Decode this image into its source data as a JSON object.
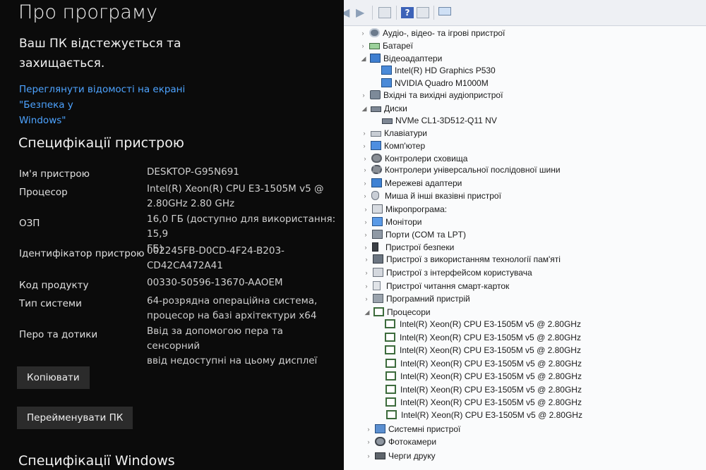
{
  "settings": {
    "page_title": "Про програму",
    "protection_line1": "Ваш ПК відстежується та",
    "protection_line2": "захищається.",
    "security_link_line1": "Переглянути відомості на екрані \"Безпека у",
    "security_link_line2": "Windows\"",
    "device_specs_title": "Специфікації пристрою",
    "specs": [
      {
        "label": "Ім'я пристрою",
        "value_line1": "DESKTOP-G95N691",
        "value_line2": ""
      },
      {
        "label": "Процесор",
        "value_line1": "Intel(R) Xeon(R) CPU E3-1505M v5 @",
        "value_line2": "2.80GHz   2.80 GHz"
      },
      {
        "label": "ОЗП",
        "value_line1": "16,0 ГБ (доступно для використання: 15,9",
        "value_line2": "ГБ)"
      },
      {
        "label": "Ідентифікатор пристрою",
        "value_line1": "002245FB-D0CD-4F24-B203-",
        "value_line2": "CD42CA472A41"
      },
      {
        "label": "Код продукту",
        "value_line1": "00330-50596-13670-AAOEM",
        "value_line2": ""
      },
      {
        "label": "Тип системи",
        "value_line1": "64-розрядна операційна система,",
        "value_line2": "процесор на базі архітектури x64"
      },
      {
        "label": "Перо та дотики",
        "value_line1": "Ввід за допомогою пера та сенсорний",
        "value_line2": "ввід недоступні на цьому дисплеї"
      }
    ],
    "copy_button": "Копіювати",
    "rename_button": "Перейменувати ПК",
    "windows_specs_title": "Специфікації Windows"
  },
  "device_manager": {
    "toolbar_icons": [
      "back-arrow-icon",
      "forward-arrow-icon",
      "properties-icon",
      "help-icon",
      "view-icon",
      "monitor-scan-icon"
    ],
    "help_glyph": "?",
    "tree": [
      {
        "label": "Аудіо-, відео- та ігрові пристрої",
        "expanded": false,
        "icon": "speaker-icon"
      },
      {
        "label": "Батареї",
        "expanded": false,
        "icon": "battery-icon"
      },
      {
        "label": "Відеоадаптери",
        "expanded": true,
        "icon": "display-adapter-icon"
      },
      {
        "label": "Intel(R) HD Graphics P530",
        "child": true,
        "icon": "gpu-icon"
      },
      {
        "label": "NVIDIA Quadro M1000M",
        "child": true,
        "icon": "gpu-icon"
      },
      {
        "label": "Вхідні та вихідні аудіопристрої",
        "expanded": false,
        "icon": "audio-io-icon"
      },
      {
        "label": "Диски",
        "expanded": true,
        "icon": "disk-icon"
      },
      {
        "label": "NVMe CL1-3D512-Q11 NV",
        "child": true,
        "icon": "disk-icon"
      },
      {
        "label": "Клавіатури",
        "expanded": false,
        "icon": "keyboard-icon"
      },
      {
        "label": "Комп'ютер",
        "expanded": false,
        "icon": "computer-icon"
      },
      {
        "label": "Контролери сховища",
        "expanded": false,
        "icon": "storage-controller-icon"
      },
      {
        "label": "Контролери універсальної послідовної шини",
        "expanded": false,
        "icon": "usb-icon"
      },
      {
        "label": "Мережеві адаптери",
        "expanded": false,
        "icon": "network-icon"
      },
      {
        "label": "Миша й інші вказівні пристрої",
        "expanded": false,
        "icon": "mouse-icon"
      },
      {
        "label": "Мікропрограма:",
        "expanded": false,
        "icon": "firmware-icon"
      },
      {
        "label": "Монітори",
        "expanded": false,
        "icon": "monitor-icon"
      },
      {
        "label": "Порти (COM та LPT)",
        "expanded": false,
        "icon": "ports-icon"
      },
      {
        "label": "Пристрої безпеки",
        "expanded": false,
        "icon": "security-device-icon"
      },
      {
        "label": "Пристрої з використанням технології пам'яті",
        "expanded": false,
        "icon": "memory-device-icon"
      },
      {
        "label": "Пристрої з інтерфейсом користувача",
        "expanded": false,
        "icon": "hid-icon"
      },
      {
        "label": "Пристрої читання смарт-карток",
        "expanded": false,
        "icon": "smartcard-reader-icon"
      },
      {
        "label": "Програмний пристрій",
        "expanded": false,
        "icon": "software-device-icon"
      },
      {
        "label": "Процесори",
        "expanded": true,
        "icon": "processor-icon"
      },
      {
        "label": "Intel(R) Xeon(R) CPU E3-1505M v5 @ 2.80GHz",
        "child": true,
        "icon": "processor-icon"
      },
      {
        "label": "Intel(R) Xeon(R) CPU E3-1505M v5 @ 2.80GHz",
        "child": true,
        "icon": "processor-icon"
      },
      {
        "label": "Intel(R) Xeon(R) CPU E3-1505M v5 @ 2.80GHz",
        "child": true,
        "icon": "processor-icon"
      },
      {
        "label": "Intel(R) Xeon(R) CPU E3-1505M v5 @ 2.80GHz",
        "child": true,
        "icon": "processor-icon"
      },
      {
        "label": "Intel(R) Xeon(R) CPU E3-1505M v5 @ 2.80GHz",
        "child": true,
        "icon": "processor-icon"
      },
      {
        "label": "Intel(R) Xeon(R) CPU E3-1505M v5 @ 2.80GHz",
        "child": true,
        "icon": "processor-icon"
      },
      {
        "label": "Intel(R) Xeon(R) CPU E3-1505M v5 @ 2.80GHz",
        "child": true,
        "icon": "processor-icon"
      },
      {
        "label": "Intel(R) Xeon(R) CPU E3-1505M v5 @ 2.80GHz",
        "child": true,
        "icon": "processor-icon"
      },
      {
        "label": "Системні пристрої",
        "expanded": false,
        "icon": "system-devices-icon"
      },
      {
        "label": "Фотокамери",
        "expanded": false,
        "icon": "camera-icon"
      },
      {
        "label": "Черги друку",
        "expanded": false,
        "icon": "print-queue-icon"
      }
    ]
  },
  "colors": {
    "settings_bg": "#0b0b0b",
    "link": "#4da3ff",
    "button_bg": "#2b2b2b",
    "devmgr_bg": "#fafbfc"
  }
}
